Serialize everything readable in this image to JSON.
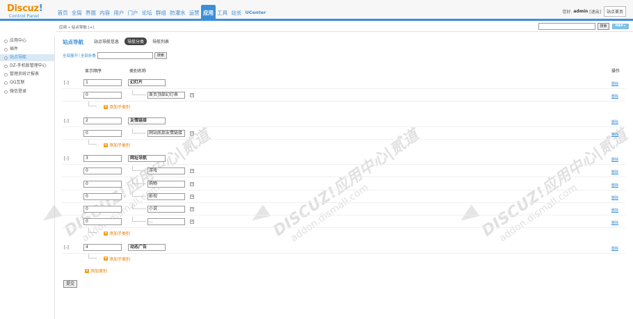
{
  "brand": {
    "name": "Discuz",
    "excl": "!",
    "sub": "Control Panel"
  },
  "topnav": [
    "首页",
    "全局",
    "界面",
    "内容",
    "用户",
    "门户",
    "论坛",
    "群组",
    "防灌水",
    "运营",
    "应用",
    "工具",
    "站长",
    "UCenter"
  ],
  "topnav_active": "应用",
  "user": {
    "greeting": "您好,",
    "name": "admin",
    "logout": "[退出]",
    "site_home": "站点首页"
  },
  "crumb": {
    "path": "应用 » 站点导航",
    "plus": "[+]",
    "search_btn": "搜索",
    "map_btn": "MAP ▸"
  },
  "sidebar": [
    "应用中心",
    "插件",
    "站点导航",
    "DZ-手机版管理中心",
    "管理员统计报表",
    "QQ互联",
    "微信登录"
  ],
  "sidebar_active_index": 2,
  "page": {
    "title": "站点导航",
    "tabs": [
      "站点导航信息",
      "导航分类",
      "导航列表"
    ],
    "current_tab_index": 1,
    "expand_all": "全部展开",
    "sep": "|",
    "collapse_all": "全部折叠",
    "search_btn": "搜索"
  },
  "table": {
    "col_order": "显示顺序",
    "col_name": "类别名称",
    "col_action": "操作",
    "delete": "删除",
    "add_child": "添加子类别",
    "add_category": "添加类别",
    "submit": "提交"
  },
  "categories": [
    {
      "toggle": "[-]",
      "order": "1",
      "name": "幻灯片",
      "children": [
        {
          "order": "0",
          "name": "首页顶部幻灯表"
        }
      ]
    },
    {
      "toggle": "[-]",
      "order": "2",
      "name": "友情链接",
      "children": [
        {
          "order": "0",
          "name": "网站底部友情链接"
        }
      ]
    },
    {
      "toggle": "[-]",
      "order": "3",
      "name": "网址导航",
      "children": [
        {
          "order": "0",
          "name": "游戏"
        },
        {
          "order": "0",
          "name": "购物"
        },
        {
          "order": "0",
          "name": "影视"
        },
        {
          "order": "0",
          "name": "小说"
        },
        {
          "order": "0",
          "name": "..."
        }
      ]
    },
    {
      "toggle": "[-]",
      "order": "4",
      "name": "动态广告",
      "children": []
    }
  ],
  "watermark": {
    "line1": "DISCUZ!应用中心|贰道",
    "line2": "addon.dismall.com"
  }
}
